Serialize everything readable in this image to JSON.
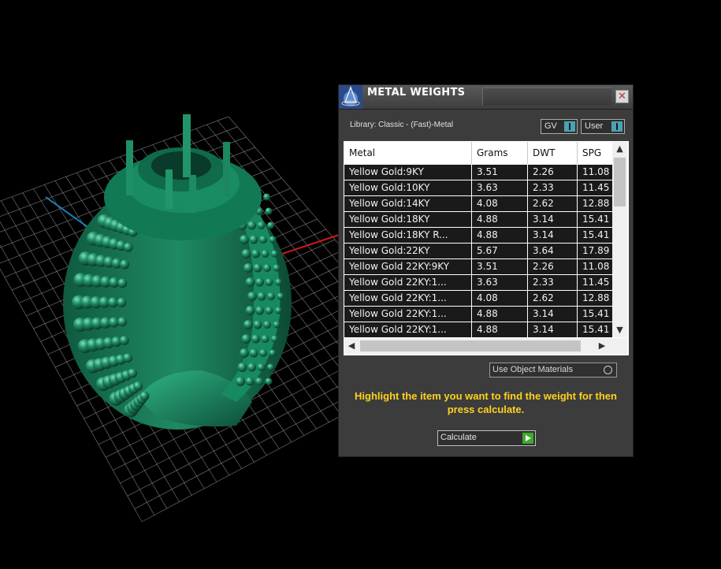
{
  "panel": {
    "title": "METAL WEIGHTS",
    "close_glyph": "✕",
    "library_label": "Library: Classic - (Fast)-Metal",
    "toggle_gv": "GV",
    "toggle_user": "User",
    "use_object_materials": "Use Object Materials",
    "instruction": "Highlight the item you want to find the weight for then press calculate.",
    "calculate": "Calculate"
  },
  "table": {
    "columns": [
      "Metal",
      "Grams",
      "DWT",
      "SPG"
    ],
    "rows": [
      [
        "Yellow Gold:9KY",
        "3.51",
        "2.26",
        "11.08"
      ],
      [
        "Yellow Gold:10KY",
        "3.63",
        "2.33",
        "11.45"
      ],
      [
        "Yellow Gold:14KY",
        "4.08",
        "2.62",
        "12.88"
      ],
      [
        "Yellow Gold:18KY",
        "4.88",
        "3.14",
        "15.41"
      ],
      [
        "Yellow Gold:18KY R...",
        "4.88",
        "3.14",
        "15.41"
      ],
      [
        "Yellow Gold:22KY",
        "5.67",
        "3.64",
        "17.89"
      ],
      [
        "Yellow Gold 22KY:9KY",
        "3.51",
        "2.26",
        "11.08"
      ],
      [
        "Yellow Gold 22KY:1...",
        "3.63",
        "2.33",
        "11.45"
      ],
      [
        "Yellow Gold 22KY:1...",
        "4.08",
        "2.62",
        "12.88"
      ],
      [
        "Yellow Gold 22KY:1...",
        "4.88",
        "3.14",
        "15.41"
      ],
      [
        "Yellow Gold 22KY:1...",
        "4.88",
        "3.14",
        "15.41"
      ]
    ]
  },
  "icons": {
    "logo": "rhino-logo-icon",
    "close": "close-icon",
    "scroll_up": "chevron-up-icon",
    "scroll_down": "chevron-down-icon",
    "scroll_left": "chevron-left-icon",
    "scroll_right": "chevron-right-icon",
    "calculate": "play-icon"
  },
  "colors": {
    "ring": "#1f7f5c",
    "grid": "#9a9a9a",
    "axis_x": "#d11a1a",
    "axis_y": "#1d7fb3",
    "instruction": "#ffd21e",
    "toggle_knob": "#4aa3b4",
    "calculate_icon": "#3faa2c"
  }
}
